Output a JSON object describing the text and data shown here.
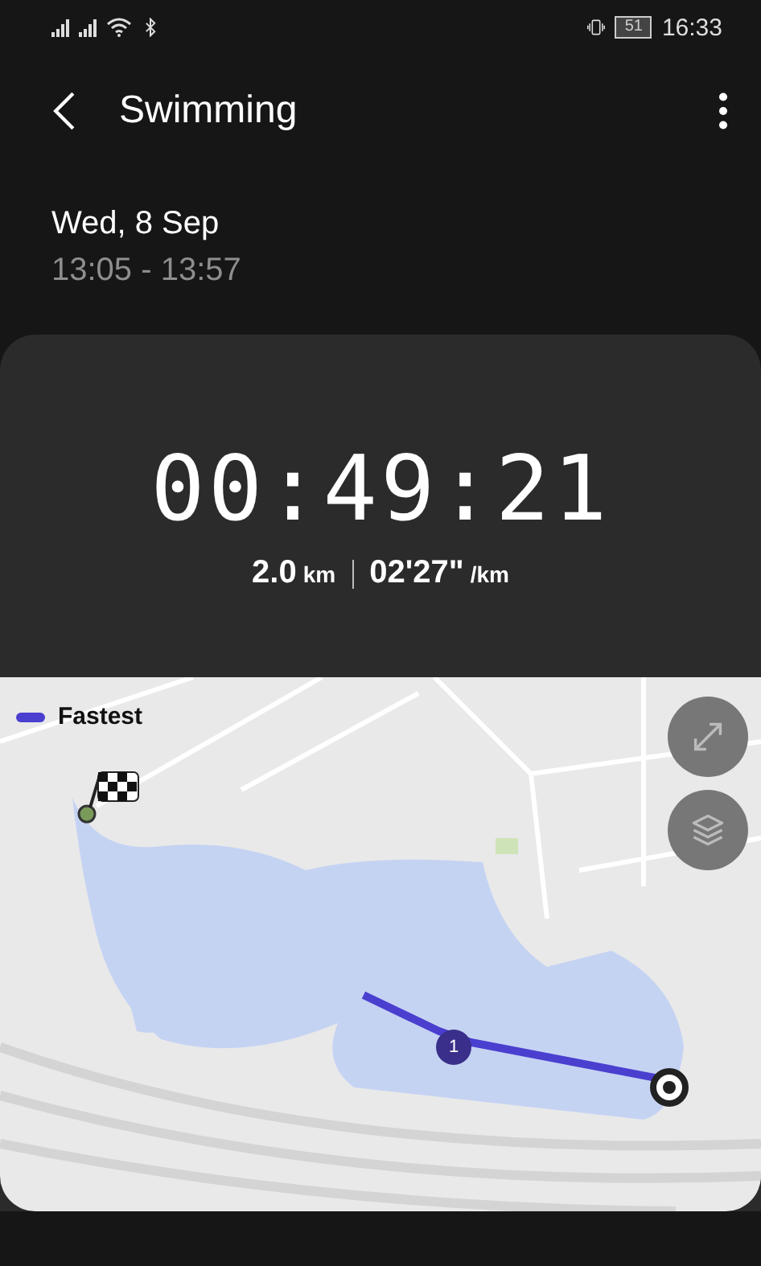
{
  "status_bar": {
    "battery": "51",
    "time": "16:33"
  },
  "header": {
    "title": "Swimming"
  },
  "session": {
    "date": "Wed, 8 Sep",
    "time_range": "13:05 - 13:57"
  },
  "summary": {
    "duration": "00:49:21",
    "distance": "2.0",
    "distance_unit": "km",
    "pace": "02'27\"",
    "pace_unit": "/km"
  },
  "map": {
    "legend": [
      {
        "label": "Fastest",
        "color": "#4a3fcf"
      }
    ],
    "lap_marker": "1"
  }
}
